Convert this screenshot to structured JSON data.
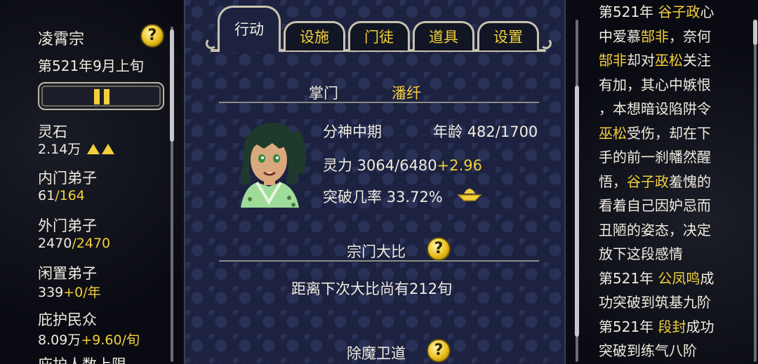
{
  "tabs": [
    {
      "label": "行动",
      "active": true
    },
    {
      "label": "设施"
    },
    {
      "label": "门徒"
    },
    {
      "label": "道具"
    },
    {
      "label": "设置"
    }
  ],
  "sidebar": {
    "sect_name": "凌霄宗",
    "date": "第521年9月上旬",
    "help_icon": "?",
    "stats": [
      {
        "label": "灵石",
        "value": "2.14万",
        "suffix": "",
        "indicator": "double-up-triangle-icon"
      },
      {
        "label": "内门弟子",
        "value": "61",
        "suffix": "/164"
      },
      {
        "label": "外门弟子",
        "value": "2470",
        "suffix": "/2470"
      },
      {
        "label": "闲置弟子",
        "value": "339",
        "suffix": "+0/年"
      },
      {
        "label": "庇护民众",
        "value": "8.09万",
        "suffix": "+9.60/旬"
      },
      {
        "label": "庇护人数上限",
        "value": "",
        "suffix": ""
      }
    ]
  },
  "leader": {
    "title_label": "掌门",
    "name": "潘纤",
    "realm": "分神中期",
    "age_label": "年龄",
    "age_value": "482/1700",
    "power_label": "灵力",
    "power_value": "3064/6480",
    "power_rate": "+2.96",
    "breakthrough_label": "突破几率",
    "breakthrough_value": "33.72%"
  },
  "tournament": {
    "title": "宗门大比",
    "info": "距离下次大比尚有212旬",
    "help_icon": "?"
  },
  "demon": {
    "title": "除魔卫道",
    "help_icon": "?"
  },
  "log": {
    "lines": [
      [
        {
          "t": "第521年 "
        },
        {
          "t": "谷子政",
          "h": true
        },
        {
          "t": "心"
        }
      ],
      [
        {
          "t": "中爱慕"
        },
        {
          "t": "郜非",
          "h": true
        },
        {
          "t": "，奈何"
        }
      ],
      [
        {
          "t": "郜非",
          "h": true
        },
        {
          "t": "却对"
        },
        {
          "t": "巫松",
          "h": true
        },
        {
          "t": "关注"
        }
      ],
      [
        {
          "t": "有加，其心中嫉恨"
        }
      ],
      [
        {
          "t": "，本想暗设陷阱令"
        }
      ],
      [
        {
          "t": "巫松",
          "h": true
        },
        {
          "t": "受伤，却在下"
        }
      ],
      [
        {
          "t": "手的前一刹幡然醒"
        }
      ],
      [
        {
          "t": "悟，"
        },
        {
          "t": "谷子政",
          "h": true
        },
        {
          "t": "羞愧的"
        }
      ],
      [
        {
          "t": "看着自己因妒忌而"
        }
      ],
      [
        {
          "t": "丑陋的姿态，决定"
        }
      ],
      [
        {
          "t": "放下这段感情"
        }
      ],
      [
        {
          "t": "第521年 "
        },
        {
          "t": "公凤鸣",
          "h": true
        },
        {
          "t": "成"
        }
      ],
      [
        {
          "t": "功突破到筑基九阶"
        }
      ],
      [
        {
          "t": "第521年 "
        },
        {
          "t": "段封",
          "h": true
        },
        {
          "t": "成功"
        }
      ],
      [
        {
          "t": "突破到练气八阶"
        }
      ]
    ]
  },
  "colors": {
    "accent": "#f3cf3a",
    "panel": "#1c2240",
    "text": "#f1ece0"
  }
}
